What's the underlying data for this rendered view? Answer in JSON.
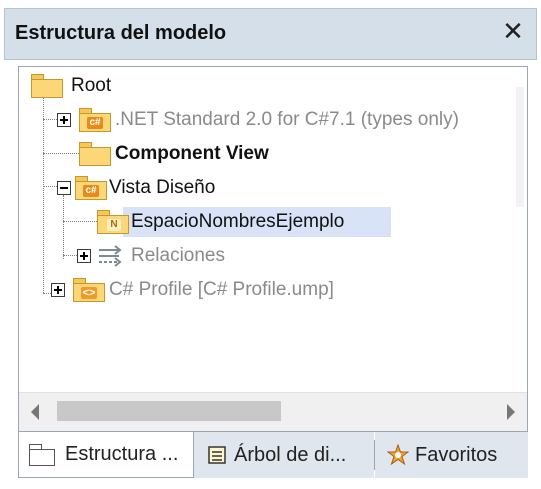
{
  "window": {
    "title": "Estructura del modelo",
    "close_symbol": "✕"
  },
  "tree": {
    "items": [
      {
        "label": "Root",
        "icon": "folder-icon",
        "style": "plain"
      },
      {
        "label": ".NET Standard 2.0 for C#7.1 (types only)",
        "icon": "csharp-folder-icon",
        "badge": "c#",
        "style": "gray",
        "expander": "plus"
      },
      {
        "label": "Component View",
        "icon": "folder-icon",
        "style": "bold"
      },
      {
        "label": "Vista Diseño",
        "icon": "csharp-folder-icon",
        "badge": "c#",
        "style": "plain",
        "expander": "minus"
      },
      {
        "label": "EspacioNombresEjemplo",
        "icon": "namespace-folder-icon",
        "badge": "N",
        "style": "plain",
        "selected": true
      },
      {
        "label": "Relaciones",
        "icon": "relations-icon",
        "style": "gray",
        "expander": "plus"
      },
      {
        "label": "C# Profile [C# Profile.ump]",
        "icon": "profile-folder-icon",
        "badge": "<>",
        "style": "gray",
        "expander": "plus"
      }
    ]
  },
  "tabs": [
    {
      "label": "Estructura ...",
      "icon": "folder-icon",
      "active": true
    },
    {
      "label": "Árbol de di...",
      "icon": "diagram-tree-icon",
      "active": false
    },
    {
      "label": "Favoritos",
      "icon": "favorites-icon",
      "active": false
    }
  ],
  "colors": {
    "titlebar": "#d5dfea",
    "selection": "#d9e3f7",
    "folder": "#fbd777",
    "csharp_badge": "#e88a1a"
  }
}
